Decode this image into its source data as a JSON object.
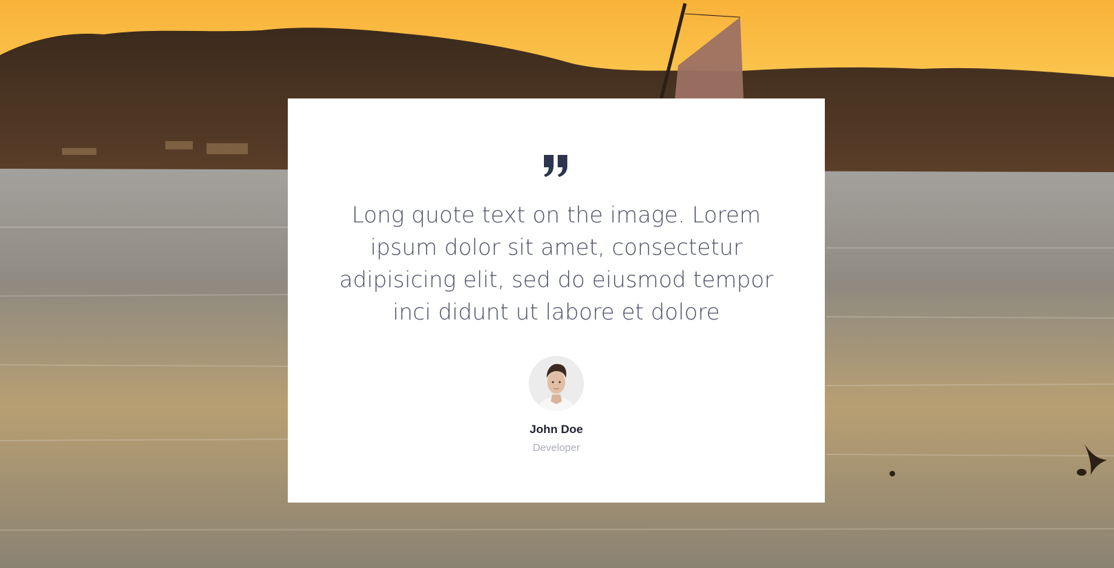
{
  "testimonial": {
    "quote": "Long quote text on the image. Lorem ipsum dolor sit amet, consectetur adipisicing elit, sed do eiusmod tempor inci didunt ut labore et dolore",
    "author_name": "John Doe",
    "author_role": "Developer"
  },
  "icons": {
    "quote": "quote-icon",
    "avatar": "avatar-photo"
  },
  "colors": {
    "quote_icon": "#2d3550",
    "quote_text": "#4a5066",
    "card_background": "#ffffff",
    "author_name": "#1f2330",
    "author_role": "#a9adb8"
  }
}
